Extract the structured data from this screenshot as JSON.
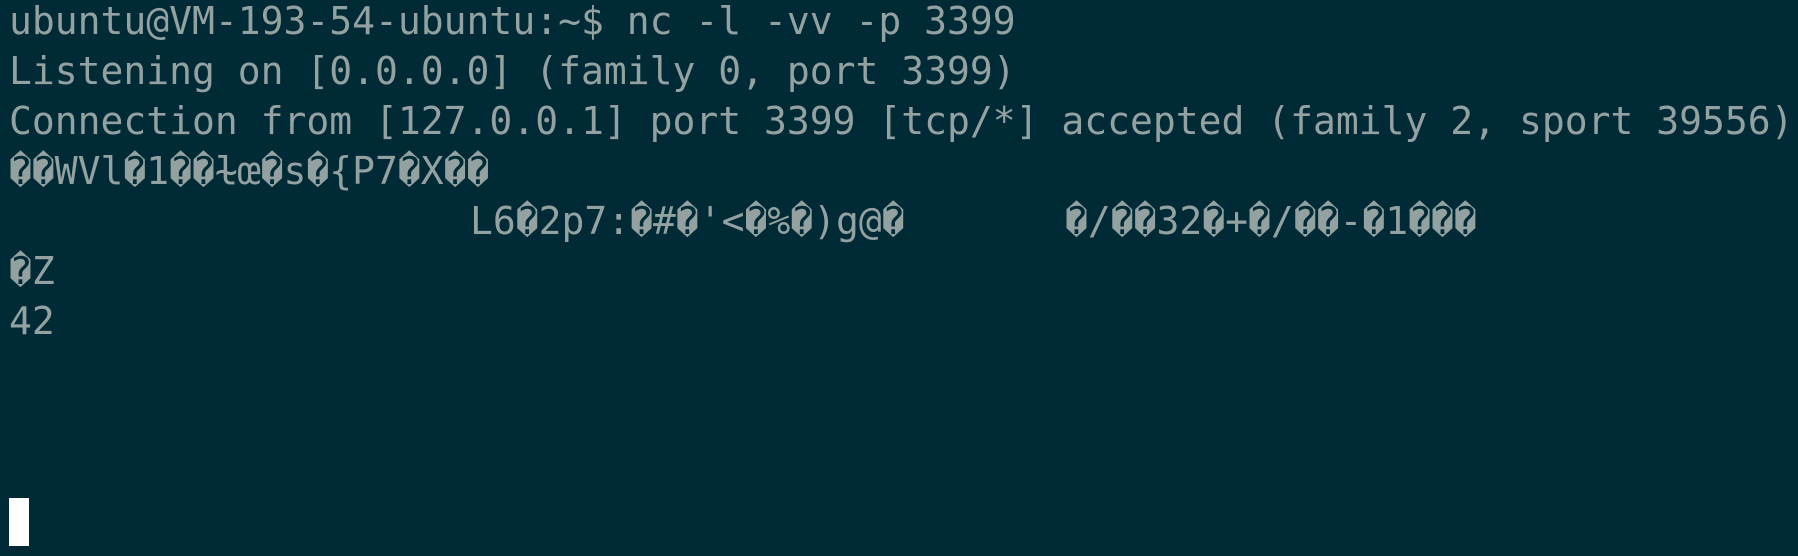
{
  "terminal": {
    "lines": [
      "ubuntu@VM-193-54-ubuntu:~$ nc -l -vv -p 3399",
      "Listening on [0.0.0.0] (family 0, port 3399)",
      "Connection from [127.0.0.1] port 3399 [tcp/*] accepted (family 2, sport 39556)",
      "��WVl�1��ɫœ�s�{P7�X��",
      "L6�2p7:�#�'<�%�)g@�",
      "�/��32�+�/��-�1���",
      "�Z",
      "42"
    ],
    "colors": {
      "background": "#002b36",
      "foreground": "#93a1a1",
      "cursor": "#ffffff"
    }
  }
}
